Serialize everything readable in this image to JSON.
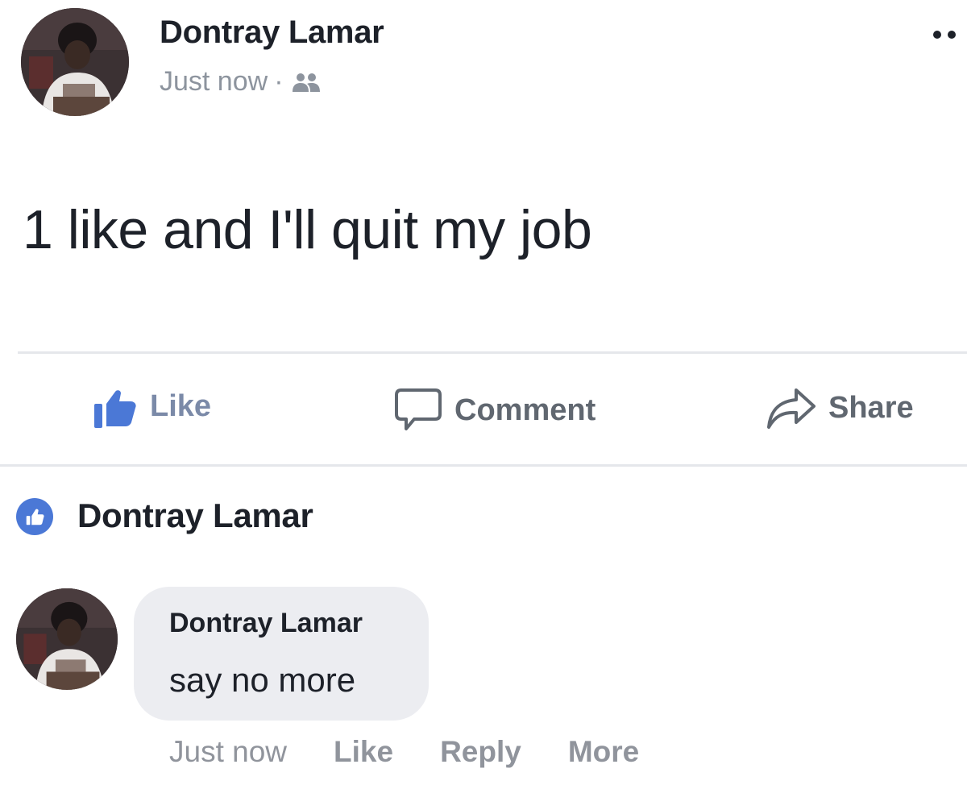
{
  "post": {
    "author": "Dontray Lamar",
    "timestamp": "Just now",
    "separator": "·",
    "audience_icon": "friends-icon",
    "options_icon": "more-dots-icon",
    "text": "1 like and I'll quit my job"
  },
  "actions": {
    "like": "Like",
    "comment": "Comment",
    "share": "Share"
  },
  "reactions": {
    "icon": "thumbs-up-icon",
    "names": "Dontray Lamar"
  },
  "comment": {
    "author": "Dontray Lamar",
    "text": "say no more",
    "timestamp": "Just now",
    "like": "Like",
    "reply": "Reply",
    "more": "More"
  },
  "colors": {
    "like_blue": "#4b78d6",
    "secondary_text": "#8d949e",
    "bubble": "#ecedf1",
    "divider": "#e5e7eb"
  }
}
